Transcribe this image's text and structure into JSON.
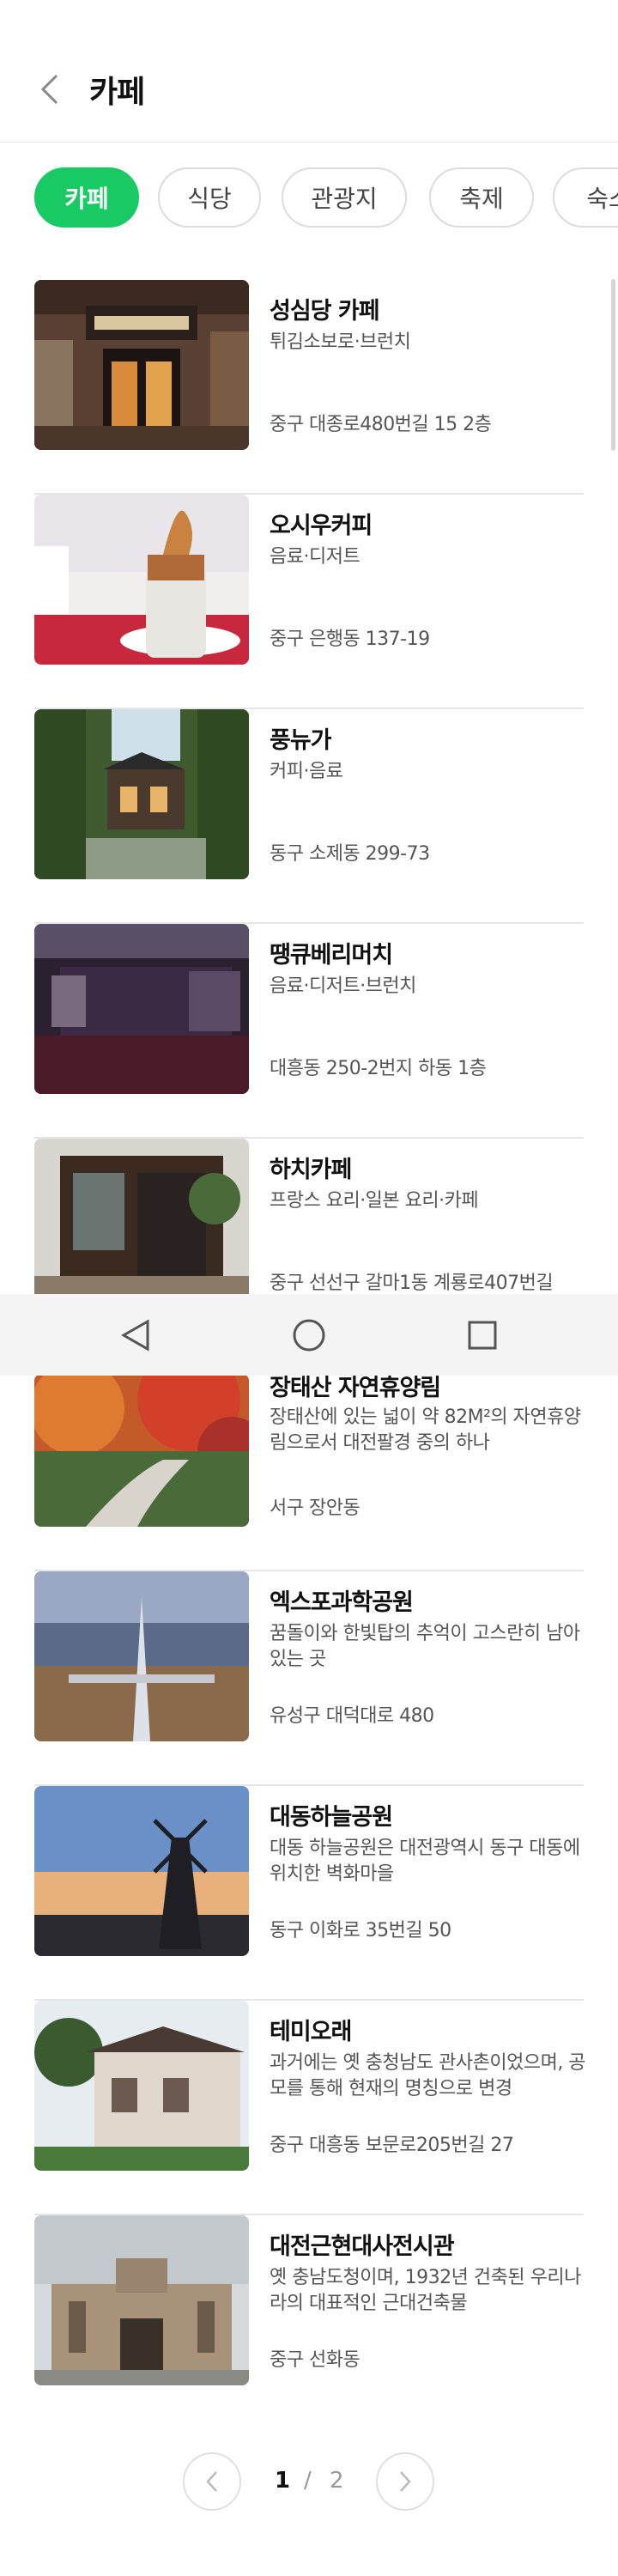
{
  "header": {
    "title": "카페"
  },
  "tabs": [
    {
      "label": "카페",
      "active": true
    },
    {
      "label": "식당",
      "active": false
    },
    {
      "label": "관광지",
      "active": false
    },
    {
      "label": "축제",
      "active": false
    },
    {
      "label": "숙소",
      "active": false
    }
  ],
  "items": [
    {
      "name": "성심당 카페",
      "desc": "튀김소보로·브런치",
      "addr": "중구 대종로480번길 15 2층"
    },
    {
      "name": "오시우커피",
      "desc": "음료·디저트",
      "addr": "중구 은행동 137-19"
    },
    {
      "name": "풍뉴가",
      "desc": "커피·음료",
      "addr": "동구 소제동 299-73"
    },
    {
      "name": "땡큐베리머치",
      "desc": "음료·디저트·브런치",
      "addr": "대흥동 250-2번지 하동 1층"
    },
    {
      "name": "하치카페",
      "desc": "프랑스 요리·일본 요리·카페",
      "addr": "중구 선선구 갈마1동 계룡로407번길"
    },
    {
      "name": "장태산 자연휴양림",
      "desc": "장태산에 있는 넓이 약 82M²의 자연휴양림으로서 대전팔경 중의 하나",
      "addr": "서구 장안동"
    },
    {
      "name": "엑스포과학공원",
      "desc": "꿈돌이와 한빛탑의 추억이 고스란히 남아있는 곳",
      "addr": "유성구 대덕대로 480"
    },
    {
      "name": "대동하늘공원",
      "desc": "대동 하늘공원은 대전광역시 동구 대동에 위치한 벽화마을",
      "addr": "동구 이화로 35번길 50"
    },
    {
      "name": "테미오래",
      "desc": "과거에는 옛 충청남도 관사촌이었으며, 공모를 통해 현재의 명칭으로 변경",
      "addr": "중구 대흥동 보문로205번길 27"
    },
    {
      "name": "대전근현대사전시관",
      "desc": "옛 충남도청이며, 1932년 건축된 우리나라의 대표적인 근대건축물",
      "addr": "중구 선화동"
    }
  ],
  "pagination": {
    "current": "1",
    "separator": "/",
    "total": "2"
  },
  "colors": {
    "accent": "#18c964",
    "text": "#111111",
    "subtext": "#555555",
    "divider": "#e6e6e6"
  }
}
